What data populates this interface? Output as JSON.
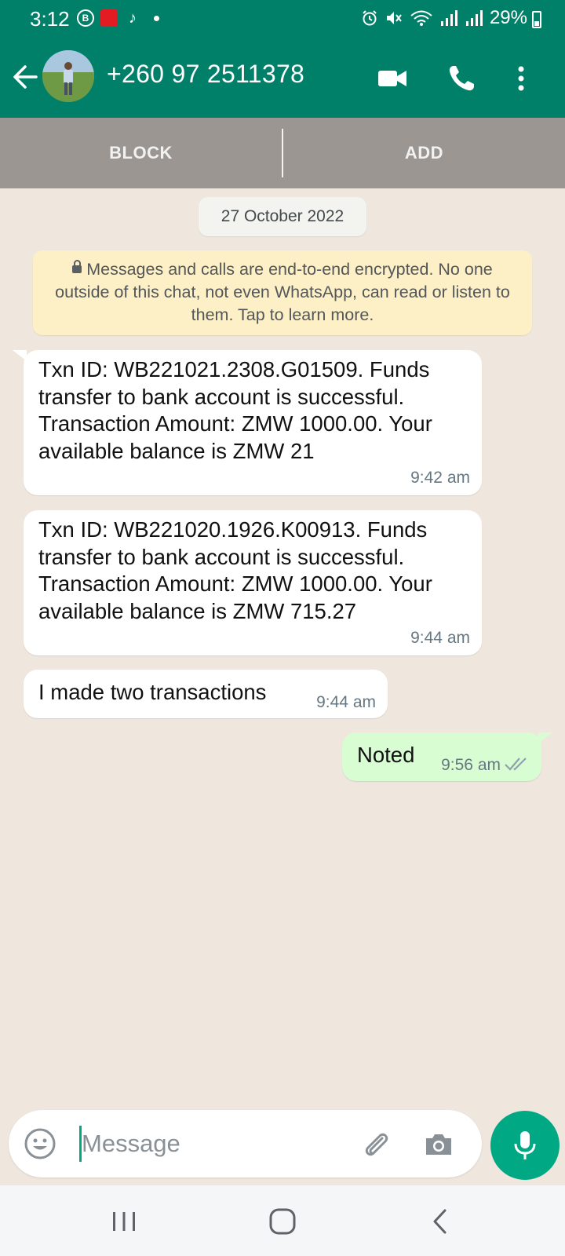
{
  "status_bar": {
    "time": "3:12",
    "battery": "29%",
    "icons": [
      "b-badge-icon",
      "airtel-icon",
      "tiktok-icon",
      "dot-icon",
      "alarm-icon",
      "mute-icon",
      "wifi-icon",
      "signal-icon",
      "signal-icon",
      "battery-icon"
    ]
  },
  "header": {
    "contact_name": "+260 97 2511378",
    "icons": [
      "back-arrow-icon",
      "avatar",
      "video-call-icon",
      "phone-icon",
      "more-vertical-icon"
    ]
  },
  "action_bar": {
    "block_label": "BLOCK",
    "add_label": "ADD"
  },
  "chat": {
    "date_chip": "27 October 2022",
    "encryption_notice": "Messages and calls are end-to-end encrypted. No one outside of this chat, not even WhatsApp, can read or listen to them. Tap to learn more.",
    "messages": [
      {
        "direction": "incoming",
        "text": "Txn ID: WB221021.2308.G01509. Funds transfer to bank account is successful. Transaction Amount: ZMW 1000.00. Your available balance is ZMW 21",
        "time": "9:42 am"
      },
      {
        "direction": "incoming",
        "text": "Txn ID: WB221020.1926.K00913. Funds transfer to bank account is successful. Transaction Amount: ZMW 1000.00. Your available balance is ZMW 715.27",
        "time": "9:44 am"
      },
      {
        "direction": "incoming",
        "text": "I made two transactions",
        "time": "9:44 am"
      },
      {
        "direction": "outgoing",
        "text": "Noted",
        "time": "9:56 am",
        "status": "read"
      }
    ]
  },
  "composer": {
    "placeholder": "Message"
  },
  "colors": {
    "header": "#008069",
    "accent": "#00a884",
    "chat_bg": "#efe7de",
    "outgoing_bubble": "#d9fdd3",
    "read_tick": "#8ea2ab"
  }
}
